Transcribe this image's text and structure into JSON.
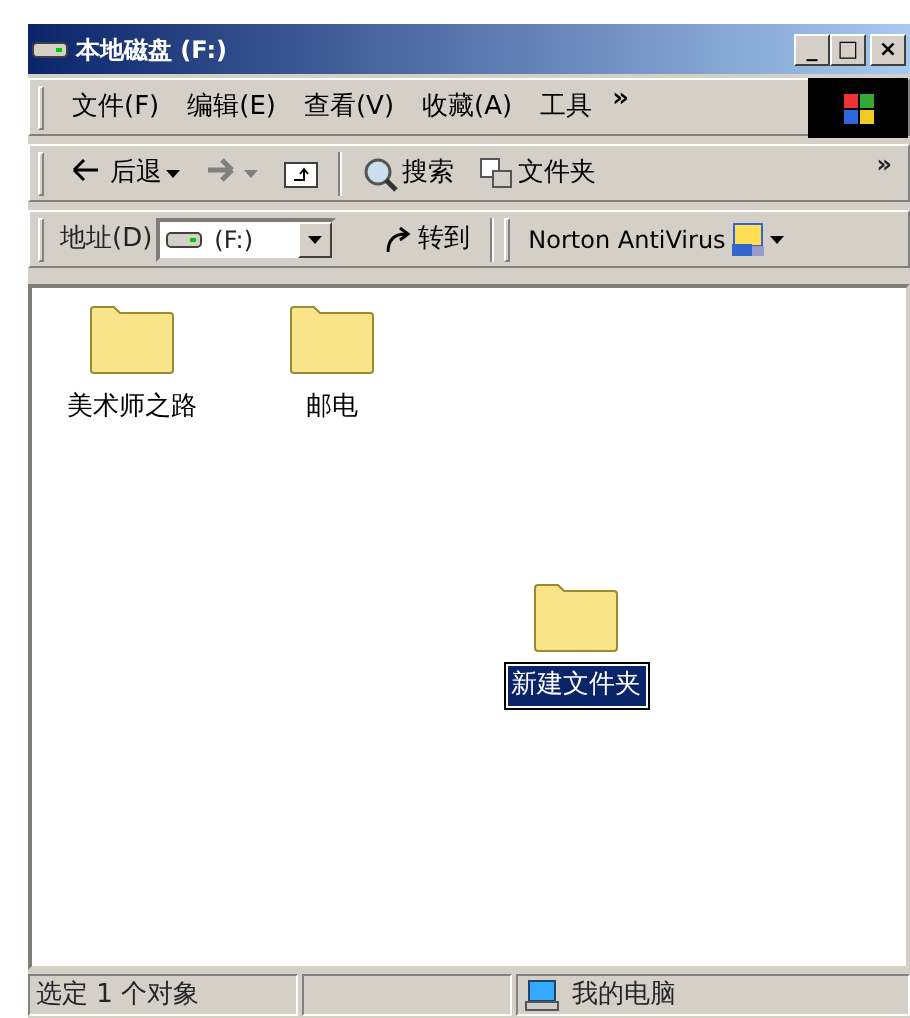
{
  "window": {
    "title": "本地磁盘 (F:)",
    "controls": [
      "_",
      "□",
      "×"
    ]
  },
  "menu": {
    "items": [
      {
        "label": "文件(F)"
      },
      {
        "label": "编辑(E)"
      },
      {
        "label": "查看(V)"
      },
      {
        "label": "收藏(A)"
      },
      {
        "label": "工具"
      }
    ],
    "more": "»"
  },
  "toolbar": {
    "buttons": [
      {
        "kind": "back",
        "label": "后退",
        "disabled": false
      },
      {
        "kind": "forward",
        "disabled": true
      },
      {
        "kind": "up"
      },
      {
        "kind": "search",
        "label": "搜索"
      },
      {
        "kind": "folders",
        "label": "文件夹"
      }
    ],
    "more": "»"
  },
  "address": {
    "label": "地址(D)",
    "value": "(F:)",
    "go": "转到",
    "plugin": "Norton AntiVirus"
  },
  "items": [
    {
      "name": "美术师之路",
      "selected": false
    },
    {
      "name": "邮电",
      "selected": false
    },
    {
      "name": "新建文件夹",
      "selected": true
    }
  ],
  "status_bar": {
    "selection": "选定 1 个对象",
    "zone": "我的电脑"
  }
}
